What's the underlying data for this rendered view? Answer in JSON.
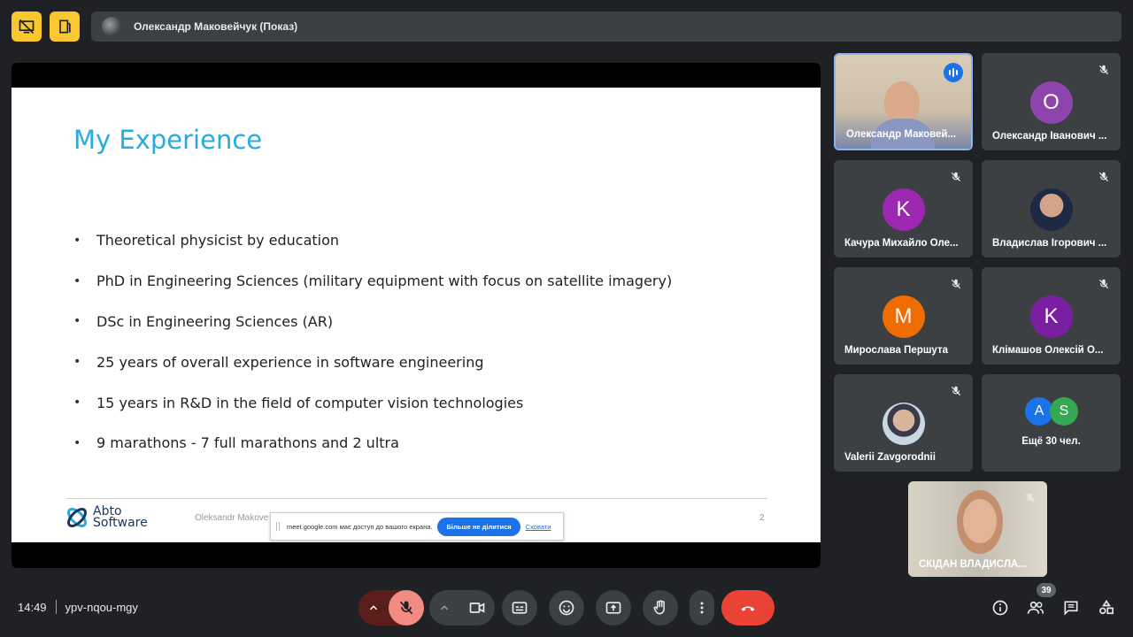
{
  "presenter": {
    "name": "Олександр Маковейчук (Показ)"
  },
  "slide": {
    "title": "My Experience",
    "bullets": [
      "Theoretical physicist by education",
      "PhD in Engineering Sciences (military equipment with focus on satellite imagery)",
      "DSc in Engineering Sciences (AR)",
      "25 years of overall experience in software engineering",
      "15 years in R&D in the field of computer vision technologies",
      "9 marathons - 7 full marathons and 2 ultra"
    ],
    "logo_line1": "Abto",
    "logo_line2": "Software",
    "footer_author": "Oleksandr Makove",
    "page_number": "2"
  },
  "share_toast": {
    "text": "meet.google.com має доступ до вашого екрана.",
    "stop_label": "Більше не ділитися",
    "hide_label": "Сховати"
  },
  "participants": [
    {
      "name": "Олександр Маковей...",
      "type": "video",
      "speaking": true
    },
    {
      "name": "Олександр Іванович ...",
      "initial": "О",
      "color": "#8e44ad"
    },
    {
      "name": "Качура Михайло Оле...",
      "initial": "K",
      "color": "#9c27b0"
    },
    {
      "name": "Владислав Ігорович ...",
      "type": "photo"
    },
    {
      "name": "Мирослава Першута",
      "initial": "M",
      "color": "#ef6c00"
    },
    {
      "name": "Клімашов Олексій О...",
      "initial": "K",
      "color": "#7b1fa2"
    },
    {
      "name": "Valerii Zavgorodnii",
      "type": "photo"
    },
    {
      "name": "Ещё 30 чел.",
      "initials": [
        "A",
        "S"
      ],
      "colors": [
        "#1a73e8",
        "#34a853"
      ]
    },
    {
      "name": "СКІДАН ВЛАДИСЛА...",
      "type": "video"
    }
  ],
  "meeting": {
    "time": "14:49",
    "code": "ypv-nqou-mgy"
  },
  "people_count": "39",
  "colors": {
    "accent": "#1a73e8",
    "end_call": "#ea4335",
    "alert": "#f9c72f",
    "mic_off": "#f28b82"
  }
}
